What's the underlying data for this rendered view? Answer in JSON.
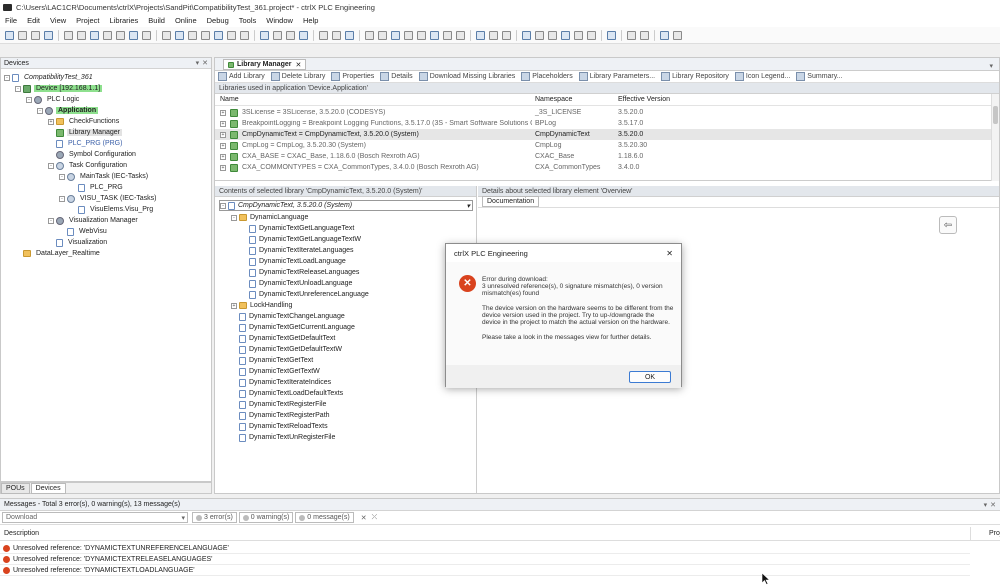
{
  "window": {
    "title": "C:\\Users\\LAC1CR\\Documents\\ctrlX\\Projects\\SandPit\\CompatibilityTest_361.project* - ctrlX PLC Engineering"
  },
  "menu": [
    "File",
    "Edit",
    "View",
    "Project",
    "Libraries",
    "Build",
    "Online",
    "Debug",
    "Tools",
    "Window",
    "Help"
  ],
  "devices": {
    "title": "Devices",
    "tree": [
      {
        "label": "CompatibilityTest_361",
        "level": 0,
        "icon": "project-icon",
        "exp": "-",
        "italic": true
      },
      {
        "label": "Device [192.168.1.1]",
        "level": 1,
        "icon": "device-icon",
        "exp": "-",
        "hl": true
      },
      {
        "label": "PLC Logic",
        "level": 2,
        "icon": "gear-icon",
        "exp": "-"
      },
      {
        "label": "Application",
        "level": 3,
        "icon": "gear-icon",
        "exp": "-",
        "hl": true,
        "bold": true
      },
      {
        "label": "CheckFunctions",
        "level": 4,
        "icon": "folder-icon",
        "exp": "+"
      },
      {
        "label": "Library Manager",
        "level": 4,
        "icon": "library-icon",
        "exp": "",
        "sel": true
      },
      {
        "label": "PLC_PRG (PRG)",
        "level": 4,
        "icon": "doc-icon",
        "exp": "",
        "link": true
      },
      {
        "label": "Symbol Configuration",
        "level": 4,
        "icon": "gear-icon",
        "exp": ""
      },
      {
        "label": "Task Configuration",
        "level": 4,
        "icon": "task-icon",
        "exp": "-"
      },
      {
        "label": "MainTask (IEC-Tasks)",
        "level": 5,
        "icon": "task-icon",
        "exp": "-"
      },
      {
        "label": "PLC_PRG",
        "level": 6,
        "icon": "doc-icon",
        "exp": ""
      },
      {
        "label": "VISU_TASK (IEC-Tasks)",
        "level": 5,
        "icon": "task-icon",
        "exp": "-"
      },
      {
        "label": "VisuElems.Visu_Prg",
        "level": 6,
        "icon": "doc-icon",
        "exp": ""
      },
      {
        "label": "Visualization Manager",
        "level": 4,
        "icon": "gear-icon",
        "exp": "-"
      },
      {
        "label": "WebVisu",
        "level": 5,
        "icon": "doc-icon",
        "exp": ""
      },
      {
        "label": "Visualization",
        "level": 4,
        "icon": "doc-icon",
        "exp": ""
      },
      {
        "label": "DataLayer_Realtime",
        "level": 1,
        "icon": "folder-icon",
        "exp": ""
      }
    ],
    "tabs": [
      "POUs",
      "Devices"
    ]
  },
  "libmgr": {
    "tab": "Library Manager",
    "toolbar": [
      "Add Library",
      "Delete Library",
      "Properties",
      "Details",
      "Download Missing Libraries",
      "Placeholders",
      "Library Parameters...",
      "Library Repository",
      "Icon Legend...",
      "Summary..."
    ],
    "section": "Libraries used in application 'Device.Application'",
    "columns": [
      "Name",
      "Namespace",
      "Effective Version"
    ],
    "rows": [
      {
        "name": "3SLicense = 3SLicense, 3.5.20.0 (CODESYS)",
        "ns": "_3S_LICENSE",
        "ver": "3.5.20.0"
      },
      {
        "name": "BreakpointLogging = Breakpoint Logging Functions, 3.5.17.0 (3S - Smart Software Solutions GmbH)",
        "ns": "BPLog",
        "ver": "3.5.17.0"
      },
      {
        "name": "CmpDynamicText = CmpDynamicText, 3.5.20.0 (System)",
        "ns": "CmpDynamicText",
        "ver": "3.5.20.0",
        "sel": true
      },
      {
        "name": "CmpLog = CmpLog, 3.5.20.30 (System)",
        "ns": "CmpLog",
        "ver": "3.5.20.30"
      },
      {
        "name": "CXA_BASE = CXAC_Base, 1.18.6.0 (Bosch Rexroth AG)",
        "ns": "CXAC_Base",
        "ver": "1.18.6.0"
      },
      {
        "name": "CXA_COMMONTYPES = CXA_CommonTypes, 3.4.0.0 (Bosch Rexroth AG)",
        "ns": "CXA_CommonTypes",
        "ver": "3.4.0.0"
      }
    ],
    "contents_title": "Contents of selected library 'CmpDynamicText, 3.5.20.0 (System)'",
    "contents_root": "CmpDynamicText, 3.5.20.0 (System)",
    "contents": [
      {
        "label": "DynamicLanguage",
        "level": 1,
        "type": "folder",
        "exp": "-"
      },
      {
        "label": "DynamicTextGetLanguageText",
        "level": 2,
        "type": "doc"
      },
      {
        "label": "DynamicTextGetLanguageTextW",
        "level": 2,
        "type": "doc"
      },
      {
        "label": "DynamicTextIterateLanguages",
        "level": 2,
        "type": "doc"
      },
      {
        "label": "DynamicTextLoadLanguage",
        "level": 2,
        "type": "doc"
      },
      {
        "label": "DynamicTextReleaseLanguages",
        "level": 2,
        "type": "doc"
      },
      {
        "label": "DynamicTextUnloadLanguage",
        "level": 2,
        "type": "doc"
      },
      {
        "label": "DynamicTextUnreferenceLanguage",
        "level": 2,
        "type": "doc"
      },
      {
        "label": "LockHandling",
        "level": 1,
        "type": "folder",
        "exp": "+"
      },
      {
        "label": "DynamicTextChangeLanguage",
        "level": 1,
        "type": "doc"
      },
      {
        "label": "DynamicTextGetCurrentLanguage",
        "level": 1,
        "type": "doc"
      },
      {
        "label": "DynamicTextGetDefaultText",
        "level": 1,
        "type": "doc"
      },
      {
        "label": "DynamicTextGetDefaultTextW",
        "level": 1,
        "type": "doc"
      },
      {
        "label": "DynamicTextGetText",
        "level": 1,
        "type": "doc"
      },
      {
        "label": "DynamicTextGetTextW",
        "level": 1,
        "type": "doc"
      },
      {
        "label": "DynamicTextIterateIndices",
        "level": 1,
        "type": "doc"
      },
      {
        "label": "DynamicTextLoadDefaultTexts",
        "level": 1,
        "type": "doc"
      },
      {
        "label": "DynamicTextRegisterFile",
        "level": 1,
        "type": "doc"
      },
      {
        "label": "DynamicTextRegisterPath",
        "level": 1,
        "type": "doc"
      },
      {
        "label": "DynamicTextReloadTexts",
        "level": 1,
        "type": "doc"
      },
      {
        "label": "DynamicTextUnRegisterFile",
        "level": 1,
        "type": "doc"
      }
    ],
    "details_title": "Details about selected library element 'Overview'",
    "details_tab": "Documentation"
  },
  "dialog": {
    "title": "ctrlX PLC Engineering",
    "message": "Error during download:\n3 unresolved reference(s), 0 signature mismatch(es), 0 version mismatch(es) found\n\nThe device version on the hardware seems to be different from the device version used in the project. Try to up-/downgrade the device in the project to match the actual version on the hardware.\n\nPlease take a look in the messages view for further details.",
    "ok": "OK"
  },
  "messages": {
    "title": "Messages - Total 3 error(s), 0 warning(s), 13 message(s)",
    "source": "Download",
    "errors": "3 error(s)",
    "warnings": "0 warning(s)",
    "msgs": "0 message(s)",
    "col_desc": "Description",
    "col_proj": "Proj",
    "rows": [
      "Unresolved reference: 'DYNAMICTEXTUNREFERENCELANGUAGE'",
      "Unresolved reference: 'DYNAMICTEXTRELEASELANGUAGES'",
      "Unresolved reference: 'DYNAMICTEXTLOADLANGUAGE'"
    ]
  }
}
